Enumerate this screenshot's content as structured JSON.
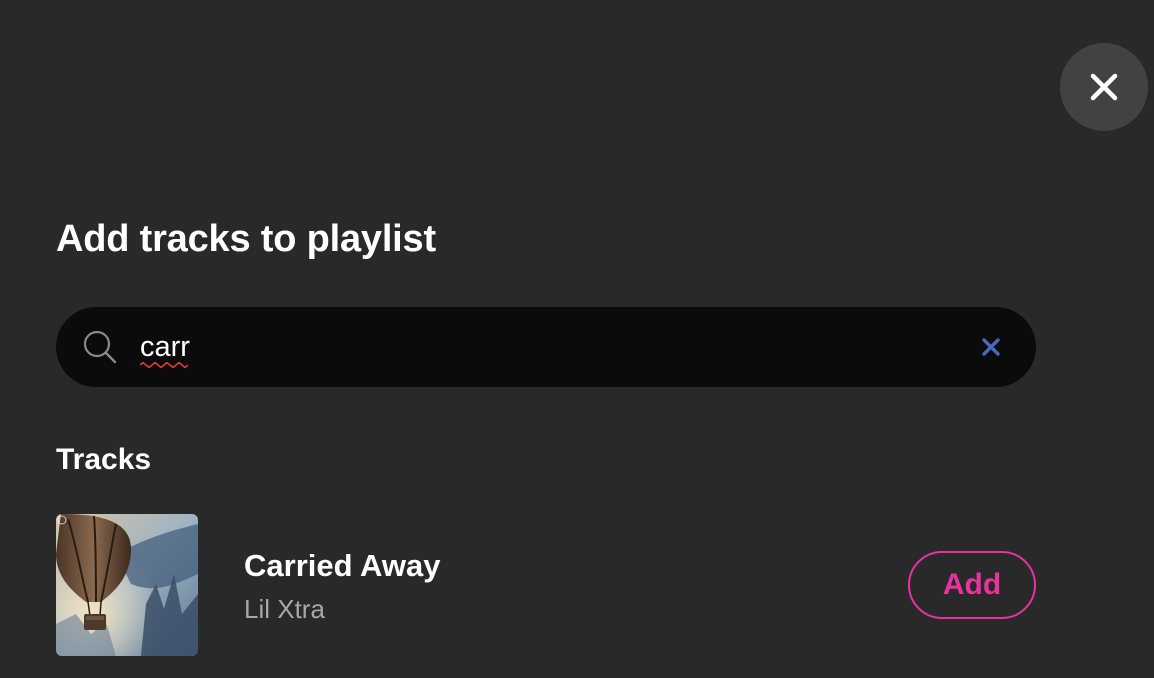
{
  "dialog": {
    "title": "Add tracks to playlist",
    "close_icon": "close-icon"
  },
  "search": {
    "value": "carr",
    "icon": "search-icon",
    "clear_icon": "clear-icon",
    "clear_color": "#4a69bd"
  },
  "tracks_section": {
    "heading": "Tracks",
    "items": [
      {
        "title": "Carried Away",
        "artist": "Lil Xtra",
        "add_label": "Add",
        "art": "hot-air-balloon-album-art"
      }
    ]
  },
  "colors": {
    "background": "#292929",
    "search_bg": "#0b0b0b",
    "accent": "#e8339f",
    "close_bg": "#424242",
    "muted_text": "#a7a7a7"
  }
}
